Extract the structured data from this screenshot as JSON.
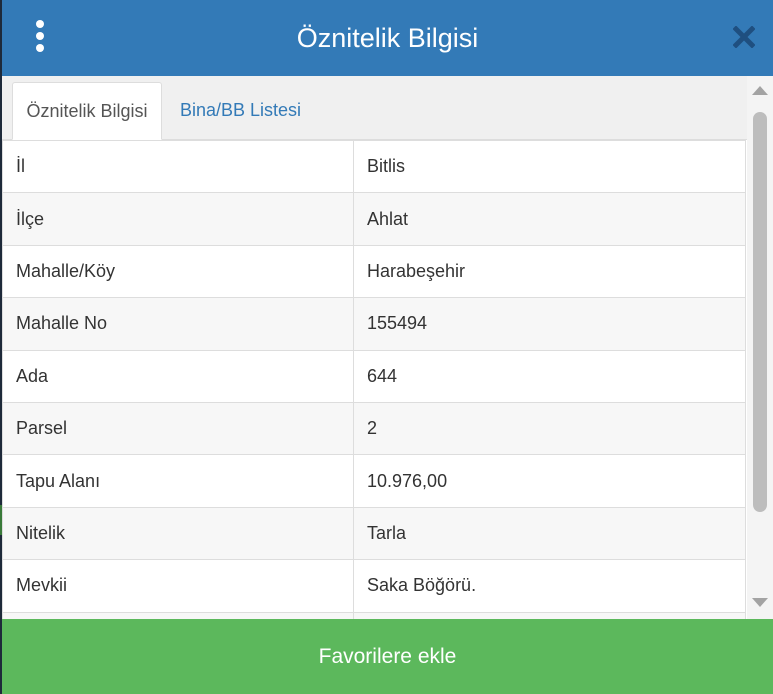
{
  "header": {
    "title": "Öznitelik Bilgisi",
    "menu_icon": "vertical-ellipsis-icon",
    "close_icon": "close-icon",
    "color": "#337ab7"
  },
  "tabs": [
    {
      "label": "Öznitelik Bilgisi",
      "active": true
    },
    {
      "label": "Bina/BB Listesi",
      "active": false
    }
  ],
  "attributes": [
    {
      "key": "İl",
      "value": "Bitlis"
    },
    {
      "key": "İlçe",
      "value": "Ahlat"
    },
    {
      "key": "Mahalle/Köy",
      "value": "Harabeşehir"
    },
    {
      "key": "Mahalle No",
      "value": "155494"
    },
    {
      "key": "Ada",
      "value": "644"
    },
    {
      "key": "Parsel",
      "value": "2"
    },
    {
      "key": "Tapu Alanı",
      "value": "10.976,00"
    },
    {
      "key": "Nitelik",
      "value": "Tarla"
    },
    {
      "key": "Mevkii",
      "value": "Saka Böğörü."
    },
    {
      "key": "",
      "value": ""
    }
  ],
  "footer": {
    "button_label": "Favorilere ekle",
    "color": "#5cb85c"
  }
}
